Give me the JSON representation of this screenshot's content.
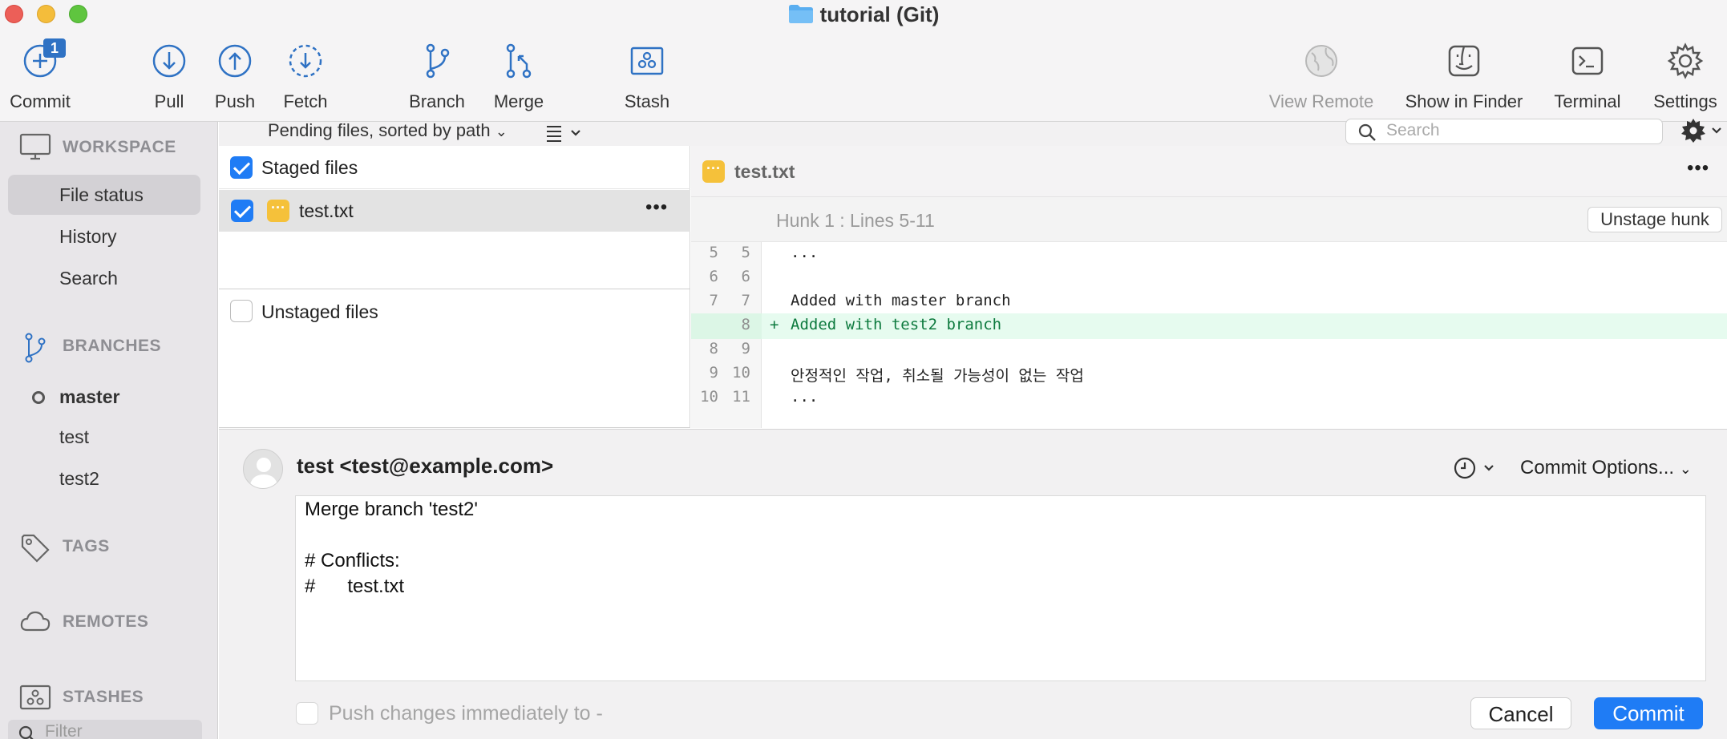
{
  "window": {
    "title": "tutorial (Git)"
  },
  "toolbar": {
    "commit": {
      "label": "Commit",
      "badge": "1"
    },
    "pull": "Pull",
    "push": "Push",
    "fetch": "Fetch",
    "branch": "Branch",
    "merge": "Merge",
    "stash": "Stash",
    "view_remote": "View Remote",
    "show_in_finder": "Show in Finder",
    "terminal": "Terminal",
    "settings": "Settings"
  },
  "sidebar": {
    "workspace": {
      "title": "WORKSPACE",
      "items": [
        "File status",
        "History",
        "Search"
      ]
    },
    "branches": {
      "title": "BRANCHES",
      "items": [
        "master",
        "test",
        "test2"
      ]
    },
    "tags": "TAGS",
    "remotes": "REMOTES",
    "stashes": "STASHES",
    "filter_placeholder": "Filter"
  },
  "files": {
    "sort_label": "Pending files, sorted by path",
    "staged_title": "Staged files",
    "staged_items": [
      {
        "name": "test.txt",
        "more": "•••"
      }
    ],
    "unstaged_title": "Unstaged files"
  },
  "search": {
    "placeholder": "Search"
  },
  "diff": {
    "filename": "test.txt",
    "more": "•••",
    "hunk_title": "Hunk 1 : Lines 5-11",
    "unstage_hunk": "Unstage hunk",
    "lines": [
      {
        "old": "5",
        "new": "5",
        "text": "...",
        "added": false
      },
      {
        "old": "6",
        "new": "6",
        "text": "",
        "added": false
      },
      {
        "old": "7",
        "new": "7",
        "text": "Added with master branch",
        "added": false
      },
      {
        "old": "",
        "new": "8",
        "text": "Added with test2 branch",
        "added": true,
        "marker": "+"
      },
      {
        "old": "8",
        "new": "9",
        "text": "",
        "added": false
      },
      {
        "old": "9",
        "new": "10",
        "text": "안정적인 작업, 취소될 가능성이 없는 작업",
        "added": false
      },
      {
        "old": "10",
        "new": "11",
        "text": "...",
        "added": false
      }
    ],
    "colors": {
      "added_bg": "#e6fbef",
      "added_text": "#0d7a3e"
    }
  },
  "commit": {
    "author": "test <test@example.com>",
    "options_label": "Commit Options...",
    "message_lines": [
      "Merge branch 'test2'",
      "",
      "# Conflicts:",
      "#      test.txt"
    ],
    "push_label": "Push changes immediately to -",
    "cancel": "Cancel",
    "commit_button": "Commit",
    "accent": "#1f7cf5"
  }
}
